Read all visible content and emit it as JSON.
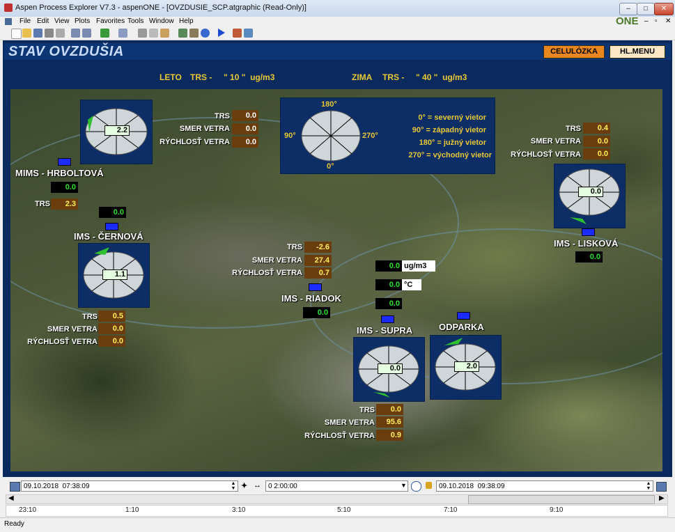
{
  "window": {
    "title": "Aspen Process Explorer V7.3 - aspenONE - [OVZDUSIE_SCP.atgraphic (Read-Only)]",
    "brand": "ONE",
    "controls": {
      "minimize": "–",
      "restore": "□",
      "close": "✕"
    },
    "mdi_controls": {
      "minimize": "–",
      "restore": "▫",
      "close": "✕"
    }
  },
  "menu": [
    "File",
    "Edit",
    "View",
    "Plots",
    "Favorites",
    "Tools",
    "Window",
    "Help"
  ],
  "page": {
    "title": "STAV OVZDUŠIA",
    "buttons": {
      "celuloza": "CELULÓZKA",
      "menu": "HL.MENU"
    },
    "legend": {
      "summer_label": "LETO",
      "summer_value": "TRS -     \" 10 \"  ug/m3",
      "winter_label": "ZIMA",
      "winter_value": "TRS -     \" 40 \"  ug/m3"
    }
  },
  "labels": {
    "trs": "TRS",
    "smer": "SMER VETRA",
    "rychlost": "RÝCHLOSŤ VETRA"
  },
  "compass": {
    "n": "180°",
    "w": "90°",
    "e": "270°",
    "s": "0°",
    "notes": [
      "0° = severný vietor",
      "90° = západný vietor",
      "180° = južný vietor",
      "270° = východný vietor"
    ]
  },
  "stations": {
    "hrboltova": {
      "name": "MIMS - HRBOLTOVÁ",
      "dial": "2.2",
      "trs": "2.3",
      "green": "0.0"
    },
    "cernova": {
      "name": "IMS - ČERNOVÁ",
      "dial": "1.1",
      "trs": "0.5",
      "smer": "0.0",
      "rychlost": "0.0",
      "green": "0.0"
    },
    "liskova": {
      "name": "IMS - LISKOVÁ",
      "dial": "0.0",
      "trs": "0.4",
      "smer": "0.0",
      "rychlost": "0.0",
      "green": "0.0"
    },
    "riadok": {
      "name": "IMS - RIADOK",
      "trs": "-2.6",
      "smer": "27.4",
      "rychlost": "0.7",
      "green": "0.0"
    },
    "supra": {
      "name": "IMS - SUPRA",
      "dial": "0.0",
      "trs": "0.0",
      "smer": "95.6",
      "rychlost": "0.9"
    },
    "odparka": {
      "name": "ODPARKA",
      "dial": "2.0"
    },
    "top": {
      "trs": "0.0",
      "smer": "0.0",
      "rychlost": "0.0"
    }
  },
  "readouts": {
    "r1": {
      "value": "0.0",
      "unit": "ug/m3"
    },
    "r2": {
      "value": "0.0",
      "unit": "°C"
    },
    "r3": {
      "value": "0.0"
    }
  },
  "timebar": {
    "start": "09.10.2018  07:38:09",
    "span": "0 2:00:00",
    "end": "09.10.2018  09:38:09",
    "ticks": [
      "23:10",
      "1:10",
      "3:10",
      "5:10",
      "7:10",
      "9:10"
    ]
  },
  "status": "Ready",
  "colors": {
    "navy": "#0a2a5e",
    "orange_button": "#e8861f",
    "cream_button": "#fde7c4",
    "value_bg": "#6b3d0c",
    "value_green": "#2fe02f",
    "legend_yellow": "#e8c933"
  }
}
